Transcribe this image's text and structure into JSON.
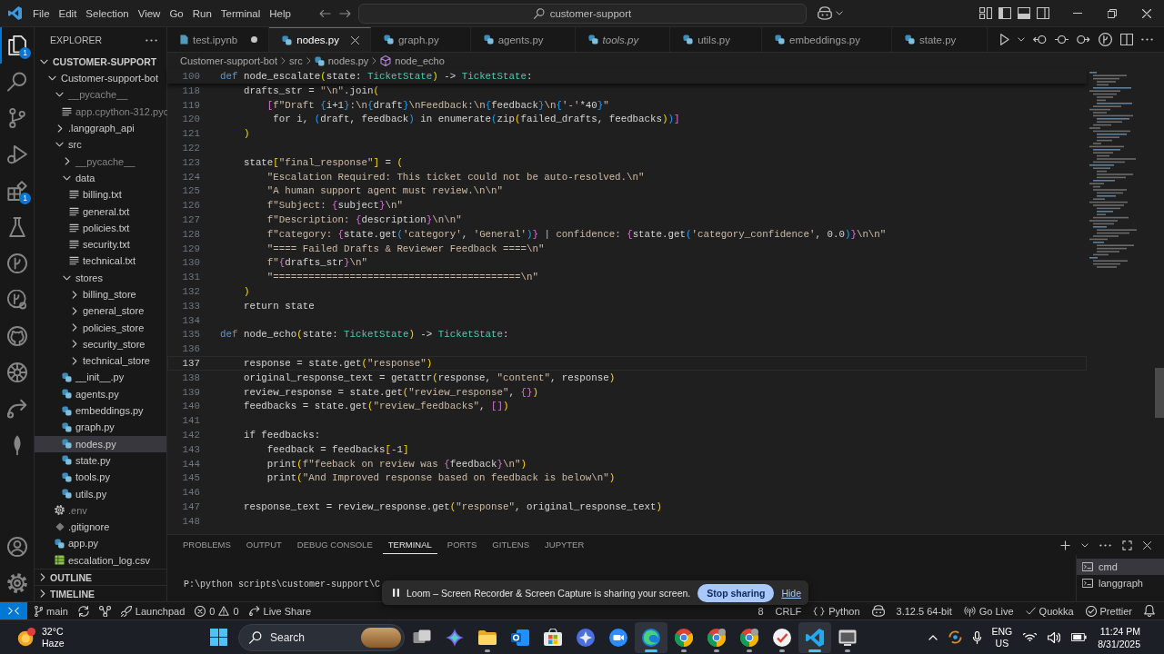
{
  "title_bar": {
    "menu": [
      "File",
      "Edit",
      "Selection",
      "View",
      "Go",
      "Run",
      "Terminal",
      "Help"
    ],
    "command_center": "customer-support"
  },
  "activity_bar": {
    "items": [
      {
        "kind": "explorer",
        "selected": true,
        "badge": "1"
      },
      {
        "kind": "search",
        "selected": false
      },
      {
        "kind": "source-control",
        "selected": false
      },
      {
        "kind": "run-debug",
        "selected": false
      },
      {
        "kind": "extensions",
        "selected": false,
        "badge": "1"
      },
      {
        "kind": "testing",
        "selected": false
      },
      {
        "kind": "git-graph",
        "selected": false
      },
      {
        "kind": "gitlens",
        "selected": false
      },
      {
        "kind": "github",
        "selected": false
      },
      {
        "kind": "kubernetes",
        "selected": false
      },
      {
        "kind": "live-share",
        "selected": false
      },
      {
        "kind": "mongodb",
        "selected": false
      }
    ],
    "bottom": [
      {
        "kind": "account"
      },
      {
        "kind": "settings"
      }
    ]
  },
  "sidebar": {
    "title": "EXPLORER",
    "sections": [
      {
        "label": "CUSTOMER-SUPPORT",
        "expanded": true,
        "tree": [
          {
            "label": "Customer-support-bot",
            "kind": "folder",
            "expanded": true,
            "ignored": false,
            "selected": false,
            "children": [
              {
                "label": "__pycache__",
                "kind": "folder",
                "expanded": true,
                "ignored": true,
                "selected": false,
                "children": [
                  {
                    "label": "app.cpython-312.pyc",
                    "kind": "binary-file",
                    "ignored": true,
                    "selected": false
                  }
                ]
              },
              {
                "label": ".langgraph_api",
                "kind": "folder",
                "expanded": false,
                "ignored": false,
                "selected": false
              },
              {
                "label": "src",
                "kind": "folder",
                "expanded": true,
                "ignored": false,
                "selected": false,
                "children": [
                  {
                    "label": "__pycache__",
                    "kind": "folder",
                    "expanded": false,
                    "ignored": true,
                    "selected": false
                  },
                  {
                    "label": "data",
                    "kind": "folder",
                    "expanded": true,
                    "ignored": false,
                    "selected": false,
                    "children": [
                      {
                        "label": "billing.txt",
                        "kind": "text-file",
                        "ignored": false,
                        "selected": false
                      },
                      {
                        "label": "general.txt",
                        "kind": "text-file",
                        "ignored": false,
                        "selected": false
                      },
                      {
                        "label": "policies.txt",
                        "kind": "text-file",
                        "ignored": false,
                        "selected": false
                      },
                      {
                        "label": "security.txt",
                        "kind": "text-file",
                        "ignored": false,
                        "selected": false
                      },
                      {
                        "label": "technical.txt",
                        "kind": "text-file",
                        "ignored": false,
                        "selected": false
                      }
                    ]
                  },
                  {
                    "label": "stores",
                    "kind": "folder",
                    "expanded": true,
                    "ignored": false,
                    "selected": false,
                    "children": [
                      {
                        "label": "billing_store",
                        "kind": "folder",
                        "expanded": false,
                        "ignored": false,
                        "selected": false
                      },
                      {
                        "label": "general_store",
                        "kind": "folder",
                        "expanded": false,
                        "ignored": false,
                        "selected": false
                      },
                      {
                        "label": "policies_store",
                        "kind": "folder",
                        "expanded": false,
                        "ignored": false,
                        "selected": false
                      },
                      {
                        "label": "security_store",
                        "kind": "folder",
                        "expanded": false,
                        "ignored": false,
                        "selected": false
                      },
                      {
                        "label": "technical_store",
                        "kind": "folder",
                        "expanded": false,
                        "ignored": false,
                        "selected": false
                      }
                    ]
                  },
                  {
                    "label": "__init__.py",
                    "kind": "python-file",
                    "ignored": false,
                    "selected": false
                  },
                  {
                    "label": "agents.py",
                    "kind": "python-file",
                    "ignored": false,
                    "selected": false
                  },
                  {
                    "label": "embeddings.py",
                    "kind": "python-file",
                    "ignored": false,
                    "selected": false
                  },
                  {
                    "label": "graph.py",
                    "kind": "python-file",
                    "ignored": false,
                    "selected": false
                  },
                  {
                    "label": "nodes.py",
                    "kind": "python-file",
                    "ignored": false,
                    "selected": true
                  },
                  {
                    "label": "state.py",
                    "kind": "python-file",
                    "ignored": false,
                    "selected": false
                  },
                  {
                    "label": "tools.py",
                    "kind": "python-file",
                    "ignored": false,
                    "selected": false
                  },
                  {
                    "label": "utils.py",
                    "kind": "python-file",
                    "ignored": false,
                    "selected": false
                  }
                ]
              },
              {
                "label": ".env",
                "kind": "config-file",
                "ignored": true,
                "selected": false
              },
              {
                "label": ".gitignore",
                "kind": "git-file",
                "ignored": false,
                "selected": false
              },
              {
                "label": "app.py",
                "kind": "python-file",
                "ignored": false,
                "selected": false
              },
              {
                "label": "escalation_log.csv",
                "kind": "csv-file",
                "ignored": false,
                "selected": false
              }
            ]
          }
        ]
      },
      {
        "label": "OUTLINE",
        "expanded": false
      },
      {
        "label": "TIMELINE",
        "expanded": false
      }
    ]
  },
  "editor": {
    "tabs": [
      {
        "label": "test.ipynb",
        "kind": "notebook",
        "selected": false,
        "modified": true,
        "preview": false
      },
      {
        "label": "nodes.py",
        "kind": "python-file",
        "selected": true,
        "modified": false,
        "preview": false
      },
      {
        "label": "graph.py",
        "kind": "python-file",
        "selected": false,
        "modified": false,
        "preview": false
      },
      {
        "label": "agents.py",
        "kind": "python-file",
        "selected": false,
        "modified": false,
        "preview": false
      },
      {
        "label": "tools.py",
        "kind": "python-file",
        "selected": false,
        "modified": false,
        "preview": true
      },
      {
        "label": "utils.py",
        "kind": "python-file",
        "selected": false,
        "modified": false,
        "preview": false
      },
      {
        "label": "embeddings.py",
        "kind": "python-file",
        "selected": false,
        "modified": false,
        "preview": false
      },
      {
        "label": "state.py",
        "kind": "python-file",
        "selected": false,
        "modified": false,
        "preview": false
      }
    ],
    "breadcrumbs": [
      {
        "label": "Customer-support-bot",
        "kind": "folder"
      },
      {
        "label": "src",
        "kind": "folder"
      },
      {
        "label": "nodes.py",
        "kind": "python-file"
      },
      {
        "label": "node_echo",
        "kind": "function"
      }
    ],
    "sticky_line": {
      "number": "100",
      "tokens": [
        {
          "kind": "kw",
          "text": "def"
        },
        {
          "kind": "plain",
          "text": " node_escalate"
        },
        {
          "kind": "b1",
          "text": "("
        },
        {
          "kind": "plain",
          "text": "state: "
        },
        {
          "kind": "type",
          "text": "TicketState"
        },
        {
          "kind": "b1",
          "text": ")"
        },
        {
          "kind": "plain",
          "text": " -> "
        },
        {
          "kind": "type",
          "text": "TicketState"
        },
        {
          "kind": "plain",
          "text": ":"
        }
      ]
    },
    "lines": [
      {
        "number": "118",
        "active": false,
        "tokens": [
          {
            "kind": "plain",
            "text": "    drafts_str = "
          },
          {
            "kind": "str",
            "text": "\"\\n\""
          },
          {
            "kind": "plain",
            "text": ".join"
          },
          {
            "kind": "b1",
            "text": "("
          }
        ]
      },
      {
        "number": "119",
        "active": false,
        "tokens": [
          {
            "kind": "b2",
            "text": "        ["
          },
          {
            "kind": "str",
            "text": "f\"Draft "
          },
          {
            "kind": "b3",
            "text": "{"
          },
          {
            "kind": "plain",
            "text": "i+1"
          },
          {
            "kind": "b3",
            "text": "}"
          },
          {
            "kind": "str",
            "text": ":\\n"
          },
          {
            "kind": "b3",
            "text": "{"
          },
          {
            "kind": "plain",
            "text": "draft"
          },
          {
            "kind": "b3",
            "text": "}"
          },
          {
            "kind": "str",
            "text": "\\nFeedback:\\n"
          },
          {
            "kind": "b3",
            "text": "{"
          },
          {
            "kind": "plain",
            "text": "feedback"
          },
          {
            "kind": "b3",
            "text": "}"
          },
          {
            "kind": "str",
            "text": "\\n"
          },
          {
            "kind": "b3",
            "text": "{"
          },
          {
            "kind": "str",
            "text": "'-'"
          },
          {
            "kind": "plain",
            "text": "*40"
          },
          {
            "kind": "b3",
            "text": "}"
          },
          {
            "kind": "str",
            "text": "\""
          }
        ]
      },
      {
        "number": "120",
        "active": false,
        "tokens": [
          {
            "kind": "plain",
            "text": "         for i, "
          },
          {
            "kind": "b3",
            "text": "("
          },
          {
            "kind": "plain",
            "text": "draft, feedback"
          },
          {
            "kind": "b3",
            "text": ")"
          },
          {
            "kind": "plain",
            "text": " in enumerate"
          },
          {
            "kind": "b3",
            "text": "("
          },
          {
            "kind": "plain",
            "text": "zip"
          },
          {
            "kind": "b1",
            "text": "("
          },
          {
            "kind": "plain",
            "text": "failed_drafts, feedbacks"
          },
          {
            "kind": "b1",
            "text": ")"
          },
          {
            "kind": "b3",
            "text": ")"
          },
          {
            "kind": "b2",
            "text": "]"
          }
        ]
      },
      {
        "number": "121",
        "active": false,
        "tokens": [
          {
            "kind": "b1",
            "text": "    )"
          }
        ]
      },
      {
        "number": "122",
        "active": false
      },
      {
        "number": "123",
        "active": false,
        "tokens": [
          {
            "kind": "plain",
            "text": "    state"
          },
          {
            "kind": "b1",
            "text": "["
          },
          {
            "kind": "str",
            "text": "\"final_response\""
          },
          {
            "kind": "b1",
            "text": "]"
          },
          {
            "kind": "plain",
            "text": " = "
          },
          {
            "kind": "b1",
            "text": "("
          }
        ]
      },
      {
        "number": "124",
        "active": false,
        "tokens": [
          {
            "kind": "str",
            "text": "        \"Escalation Required: This ticket could not be auto-resolved.\\n\""
          }
        ]
      },
      {
        "number": "125",
        "active": false,
        "tokens": [
          {
            "kind": "str",
            "text": "        \"A human support agent must review.\\n\\n\""
          }
        ]
      },
      {
        "number": "126",
        "active": false,
        "tokens": [
          {
            "kind": "str",
            "text": "        f\"Subject: "
          },
          {
            "kind": "b2",
            "text": "{"
          },
          {
            "kind": "plain",
            "text": "subject"
          },
          {
            "kind": "b2",
            "text": "}"
          },
          {
            "kind": "str",
            "text": "\\n\""
          }
        ]
      },
      {
        "number": "127",
        "active": false,
        "tokens": [
          {
            "kind": "str",
            "text": "        f\"Description: "
          },
          {
            "kind": "b2",
            "text": "{"
          },
          {
            "kind": "plain",
            "text": "description"
          },
          {
            "kind": "b2",
            "text": "}"
          },
          {
            "kind": "str",
            "text": "\\n\\n\""
          }
        ]
      },
      {
        "number": "128",
        "active": false,
        "tokens": [
          {
            "kind": "str",
            "text": "        f\"category: "
          },
          {
            "kind": "b2",
            "text": "{"
          },
          {
            "kind": "plain",
            "text": "state.get"
          },
          {
            "kind": "b3",
            "text": "("
          },
          {
            "kind": "str",
            "text": "'category'"
          },
          {
            "kind": "plain",
            "text": ", "
          },
          {
            "kind": "str",
            "text": "'General'"
          },
          {
            "kind": "b3",
            "text": ")"
          },
          {
            "kind": "b2",
            "text": "}"
          },
          {
            "kind": "str",
            "text": " | confidence: "
          },
          {
            "kind": "b2",
            "text": "{"
          },
          {
            "kind": "plain",
            "text": "state.get"
          },
          {
            "kind": "b3",
            "text": "("
          },
          {
            "kind": "str",
            "text": "'category_confidence'"
          },
          {
            "kind": "plain",
            "text": ", 0.0"
          },
          {
            "kind": "b3",
            "text": ")"
          },
          {
            "kind": "b2",
            "text": "}"
          },
          {
            "kind": "str",
            "text": "\\n\\n\""
          }
        ]
      },
      {
        "number": "129",
        "active": false,
        "tokens": [
          {
            "kind": "str",
            "text": "        \"==== Failed Drafts & Reviewer Feedback ====\\n\""
          }
        ]
      },
      {
        "number": "130",
        "active": false,
        "tokens": [
          {
            "kind": "str",
            "text": "        f\""
          },
          {
            "kind": "b2",
            "text": "{"
          },
          {
            "kind": "plain",
            "text": "drafts_str"
          },
          {
            "kind": "b2",
            "text": "}"
          },
          {
            "kind": "str",
            "text": "\\n\""
          }
        ]
      },
      {
        "number": "131",
        "active": false,
        "tokens": [
          {
            "kind": "str",
            "text": "        \"==========================================\\n\""
          }
        ]
      },
      {
        "number": "132",
        "active": false,
        "tokens": [
          {
            "kind": "b1",
            "text": "    )"
          }
        ]
      },
      {
        "number": "133",
        "active": false,
        "tokens": [
          {
            "kind": "plain",
            "text": "    return state"
          }
        ]
      },
      {
        "number": "134",
        "active": false
      },
      {
        "number": "135",
        "active": false,
        "tokens": [
          {
            "kind": "kw",
            "text": "def"
          },
          {
            "kind": "plain",
            "text": " node_echo"
          },
          {
            "kind": "b1",
            "text": "("
          },
          {
            "kind": "plain",
            "text": "state: "
          },
          {
            "kind": "type",
            "text": "TicketState"
          },
          {
            "kind": "b1",
            "text": ")"
          },
          {
            "kind": "plain",
            "text": " -> "
          },
          {
            "kind": "type",
            "text": "TicketState"
          },
          {
            "kind": "plain",
            "text": ":"
          }
        ]
      },
      {
        "number": "136",
        "active": false
      },
      {
        "number": "137",
        "active": true,
        "tokens": [
          {
            "kind": "plain",
            "text": "    response = state.get"
          },
          {
            "kind": "b1",
            "text": "("
          },
          {
            "kind": "str",
            "text": "\"response\""
          },
          {
            "kind": "b1",
            "text": ")"
          }
        ]
      },
      {
        "number": "138",
        "active": false,
        "tokens": [
          {
            "kind": "plain",
            "text": "    original_response_text = getattr"
          },
          {
            "kind": "b1",
            "text": "("
          },
          {
            "kind": "plain",
            "text": "response, "
          },
          {
            "kind": "str",
            "text": "\"content\""
          },
          {
            "kind": "plain",
            "text": ", response"
          },
          {
            "kind": "b1",
            "text": ")"
          }
        ]
      },
      {
        "number": "139",
        "active": false,
        "tokens": [
          {
            "kind": "plain",
            "text": "    review_response = state.get"
          },
          {
            "kind": "b1",
            "text": "("
          },
          {
            "kind": "str",
            "text": "\"review_response\""
          },
          {
            "kind": "plain",
            "text": ", "
          },
          {
            "kind": "b2",
            "text": "{}"
          },
          {
            "kind": "b1",
            "text": ")"
          }
        ]
      },
      {
        "number": "140",
        "active": false,
        "tokens": [
          {
            "kind": "plain",
            "text": "    feedbacks = state.get"
          },
          {
            "kind": "b1",
            "text": "("
          },
          {
            "kind": "str",
            "text": "\"review_feedbacks\""
          },
          {
            "kind": "plain",
            "text": ", "
          },
          {
            "kind": "b2",
            "text": "[]"
          },
          {
            "kind": "b1",
            "text": ")"
          }
        ]
      },
      {
        "number": "141",
        "active": false
      },
      {
        "number": "142",
        "active": false,
        "tokens": [
          {
            "kind": "plain",
            "text": "    if feedbacks:"
          }
        ]
      },
      {
        "number": "143",
        "active": false,
        "tokens": [
          {
            "kind": "plain",
            "text": "        feedback = feedbacks"
          },
          {
            "kind": "b1",
            "text": "["
          },
          {
            "kind": "plain",
            "text": "-1"
          },
          {
            "kind": "b1",
            "text": "]"
          }
        ]
      },
      {
        "number": "144",
        "active": false,
        "tokens": [
          {
            "kind": "plain",
            "text": "        print"
          },
          {
            "kind": "b1",
            "text": "("
          },
          {
            "kind": "str",
            "text": "f\"feeback on review was "
          },
          {
            "kind": "b2",
            "text": "{"
          },
          {
            "kind": "plain",
            "text": "feedback"
          },
          {
            "kind": "b2",
            "text": "}"
          },
          {
            "kind": "str",
            "text": "\\n\""
          },
          {
            "kind": "b1",
            "text": ")"
          }
        ]
      },
      {
        "number": "145",
        "active": false,
        "tokens": [
          {
            "kind": "plain",
            "text": "        print"
          },
          {
            "kind": "b1",
            "text": "("
          },
          {
            "kind": "str",
            "text": "\"And Improved response based on feedback is below\\n\""
          },
          {
            "kind": "b1",
            "text": ")"
          }
        ]
      },
      {
        "number": "146",
        "active": false
      },
      {
        "number": "147",
        "active": false,
        "tokens": [
          {
            "kind": "plain",
            "text": "    response_text = review_response.get"
          },
          {
            "kind": "b1",
            "text": "("
          },
          {
            "kind": "str",
            "text": "\"response\""
          },
          {
            "kind": "plain",
            "text": ", original_response_text"
          },
          {
            "kind": "b1",
            "text": ")"
          }
        ]
      },
      {
        "number": "148",
        "active": false
      }
    ]
  },
  "panel": {
    "tabs": [
      {
        "label": "PROBLEMS",
        "selected": false
      },
      {
        "label": "OUTPUT",
        "selected": false
      },
      {
        "label": "DEBUG CONSOLE",
        "selected": false
      },
      {
        "label": "TERMINAL",
        "selected": true
      },
      {
        "label": "PORTS",
        "selected": false
      },
      {
        "label": "GITLENS",
        "selected": false
      },
      {
        "label": "JUPYTER",
        "selected": false
      }
    ],
    "terminal_output": "P:\\python scripts\\customer-support\\C",
    "terminals": [
      {
        "label": "cmd",
        "selected": true
      },
      {
        "label": "langgraph",
        "selected": false
      }
    ]
  },
  "loom_banner": {
    "message": "Loom – Screen Recorder & Screen Capture is sharing your screen.",
    "stop_button": "Stop sharing",
    "hide_link": "Hide"
  },
  "status_bar": {
    "left": [
      {
        "kind": "remote"
      },
      {
        "kind": "branch",
        "label": "main"
      },
      {
        "kind": "sync"
      },
      {
        "kind": "graph"
      },
      {
        "kind": "launchpad",
        "label": "Launchpad"
      },
      {
        "kind": "problems",
        "errors": "0",
        "warnings": "0"
      },
      {
        "kind": "live-share",
        "label": "Live Share"
      }
    ],
    "right": [
      {
        "kind": "text",
        "label": "8"
      },
      {
        "kind": "text",
        "label": "CRLF"
      },
      {
        "kind": "language",
        "label": "Python"
      },
      {
        "kind": "copilot"
      },
      {
        "kind": "text",
        "label": "3.12.5 64-bit"
      },
      {
        "kind": "broadcast",
        "label": "Go Live"
      },
      {
        "kind": "quokka",
        "label": "Quokka"
      },
      {
        "kind": "prettier",
        "label": "Prettier"
      },
      {
        "kind": "bell"
      }
    ]
  },
  "taskbar": {
    "weather": {
      "temperature": "32°C",
      "condition": "Haze"
    },
    "search": {
      "placeholder": "Search"
    },
    "apps": [
      {
        "kind": "task-view",
        "running": false,
        "active": false
      },
      {
        "kind": "copilot",
        "running": false,
        "active": false
      },
      {
        "kind": "file-explorer",
        "running": true,
        "active": false
      },
      {
        "kind": "mail",
        "running": false,
        "active": false
      },
      {
        "kind": "store",
        "running": false,
        "active": false
      },
      {
        "kind": "assistant",
        "running": false,
        "active": false
      },
      {
        "kind": "video-call",
        "running": false,
        "active": false
      },
      {
        "kind": "edge",
        "running": true,
        "active": true
      },
      {
        "kind": "chrome",
        "running": true,
        "active": false
      },
      {
        "kind": "chrome-profile",
        "running": true,
        "active": false
      },
      {
        "kind": "chrome-profile",
        "running": true,
        "active": false
      },
      {
        "kind": "checklist",
        "running": true,
        "active": false
      },
      {
        "kind": "vscode",
        "running": true,
        "active": true
      },
      {
        "kind": "window",
        "running": true,
        "active": false
      }
    ],
    "tray": {
      "language": "ENG",
      "region": "US",
      "time": "11:24 PM",
      "date": "8/31/2025"
    }
  }
}
